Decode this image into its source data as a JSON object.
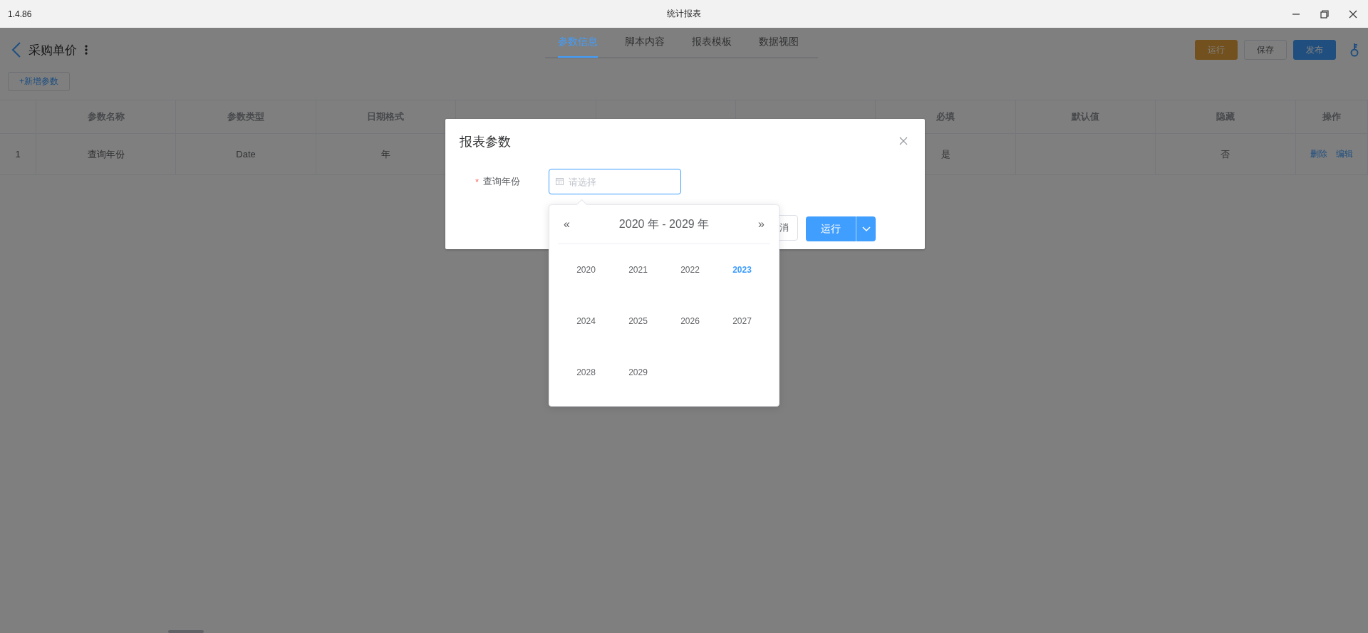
{
  "window": {
    "version": "1.4.86",
    "title": "统计报表"
  },
  "header": {
    "title": "采购单价",
    "tabs": [
      {
        "label": "参数信息",
        "selected": true
      },
      {
        "label": "脚本内容",
        "selected": false
      },
      {
        "label": "报表模板",
        "selected": false
      },
      {
        "label": "数据视图",
        "selected": false
      }
    ],
    "buttons": [
      {
        "label": "运行",
        "kind": "warning"
      },
      {
        "label": "保存",
        "kind": "plain"
      },
      {
        "label": "发布",
        "kind": "primary"
      }
    ]
  },
  "add_button": "+新增参数",
  "table": {
    "columns": [
      "参数名称",
      "参数类型",
      "日期格式",
      "必填",
      "默认值",
      "隐藏",
      "操作"
    ],
    "rows": [
      {
        "index": "1",
        "name": "查询年份",
        "type": "Date",
        "date_format": "年",
        "required": "是",
        "hidden": "否",
        "actions": [
          "删除",
          "编辑"
        ]
      }
    ]
  },
  "dialog": {
    "title": "报表参数",
    "field": {
      "label": "查询年份",
      "required": true,
      "required_mark": "*",
      "placeholder": "请选择"
    },
    "cancel_button": "消",
    "run_button": "运行"
  },
  "year_picker": {
    "range": "2020 年 - 2029 年",
    "prev": "«",
    "next": "»",
    "years": [
      {
        "label": "2020",
        "selected": false
      },
      {
        "label": "2021",
        "selected": false
      },
      {
        "label": "2022",
        "selected": false
      },
      {
        "label": "2023",
        "selected": true
      },
      {
        "label": "2024",
        "selected": false
      },
      {
        "label": "2025",
        "selected": false
      },
      {
        "label": "2026",
        "selected": false
      },
      {
        "label": "2027",
        "selected": false
      },
      {
        "label": "2028",
        "selected": false
      },
      {
        "label": "2029",
        "selected": false
      }
    ]
  }
}
